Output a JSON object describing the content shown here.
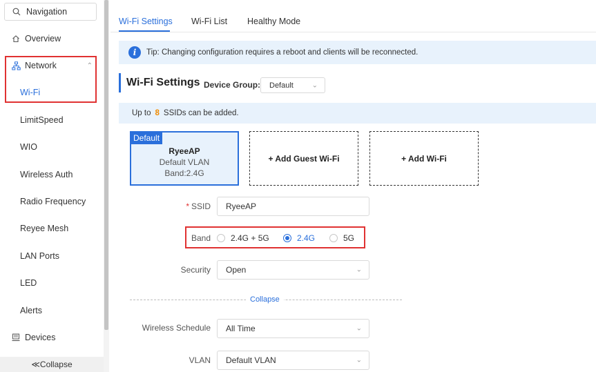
{
  "sidebar": {
    "search_label": "Navigation",
    "items": [
      {
        "label": "Overview",
        "icon": "home-icon"
      },
      {
        "label": "Network",
        "icon": "network-icon"
      },
      {
        "label": "Wi-Fi"
      },
      {
        "label": "LimitSpeed"
      },
      {
        "label": "WIO"
      },
      {
        "label": "Wireless Auth"
      },
      {
        "label": "Radio Frequency"
      },
      {
        "label": "Reyee Mesh"
      },
      {
        "label": "LAN Ports"
      },
      {
        "label": "LED"
      },
      {
        "label": "Alerts"
      },
      {
        "label": "Devices",
        "icon": "devices-icon"
      }
    ],
    "collapse_label": "≪Collapse"
  },
  "tabs": [
    "Wi-Fi Settings",
    "Wi-Fi List",
    "Healthy Mode"
  ],
  "tip": {
    "icon": "info-icon",
    "text": "Tip: Changing configuration requires a reboot and clients will be reconnected."
  },
  "section": {
    "title": "Wi-Fi Settings",
    "device_group_label": "Device Group:",
    "device_group_value": "Default"
  },
  "ssid_info": {
    "prefix": "Up to",
    "count": "8",
    "suffix": "SSIDs can be added."
  },
  "cards": {
    "default": {
      "badge": "Default",
      "name": "RyeeAP",
      "vlan": "Default VLAN",
      "band": "Band:2.4G"
    },
    "add_guest": "+ Add Guest Wi-Fi",
    "add_wifi": "+ Add Wi-Fi"
  },
  "form": {
    "ssid_required": "*",
    "ssid_label": "SSID",
    "ssid_value": "RyeeAP",
    "band_label": "Band",
    "band_options": [
      "2.4G + 5G",
      "2.4G",
      "5G"
    ],
    "band_selected": "2.4G",
    "security_label": "Security",
    "security_value": "Open",
    "collapse_label": "Collapse",
    "schedule_label": "Wireless Schedule",
    "schedule_value": "All Time",
    "vlan_label": "VLAN",
    "vlan_value": "Default VLAN"
  },
  "colors": {
    "accent": "#2a6fdb",
    "highlight": "#e03131",
    "tip_bg": "#e8f2fc",
    "count": "#f08c00"
  }
}
